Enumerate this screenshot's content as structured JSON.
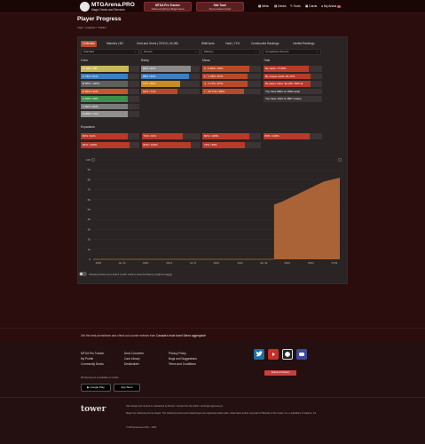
{
  "header": {
    "logo_title": "MTGArena.PRO",
    "logo_subtitle": "Magic Decks and Services",
    "promo1": {
      "title": "MTGA Pro Tracker",
      "subtitle": "Track everything in Magic Arena"
    },
    "promo2": {
      "title": "Site Tour!",
      "subtitle": "All you need to know!"
    },
    "nav": [
      "Meta",
      "Decks",
      "Tools",
      "Cards",
      "My Arena"
    ],
    "nav_badge": "1"
  },
  "page": {
    "title": "Player Progress",
    "breadcrumb": "mtga > progress > Tracker"
  },
  "tabs": [
    "Collection",
    "Matches | 8/2",
    "Gold and Gems | 29,910 | 40,060",
    "WildCards",
    "Vault | 71%",
    "Constructed Rankings",
    "Limited Rankings"
  ],
  "selects": [
    "Standard",
    "All sets",
    "Mastery",
    "Completion Percent"
  ],
  "sections": {
    "color": "Color",
    "rarity": "Rarity",
    "mana": "Mana",
    "total": "Total",
    "expansion": "Expansion"
  },
  "colors": [
    {
      "label": "W 480 / 488",
      "pct": 0.82,
      "color": "#c9b85a"
    },
    {
      "label": "U 75% / 91%",
      "pct": 0.8,
      "color": "#3d7fbf"
    },
    {
      "label": "B 80% / 100%",
      "pct": 0.8,
      "color": "#5f5f5f"
    },
    {
      "label": "R 80% / 93%",
      "pct": 0.8,
      "color": "#c9552a"
    },
    {
      "label": "G 80% / 90%",
      "pct": 0.8,
      "color": "#3e8f4a"
    },
    {
      "label": "C 80% / 80%",
      "pct": 0.8,
      "color": "#7a7a7a"
    },
    {
      "label": "M 80% / 71%",
      "pct": 0.8,
      "color": "#8f8f8f"
    }
  ],
  "rarity": [
    {
      "label": "80% / 90%",
      "pct": 0.85,
      "color": "#8a8a8a"
    },
    {
      "label": "88% / 90%",
      "pct": 0.82,
      "color": "#3d7fbf"
    },
    {
      "label": "67% / 80%",
      "pct": 0.67,
      "color": "#c98a20"
    },
    {
      "label": "62% / 71%",
      "pct": 0.62,
      "color": "#b84a2a"
    }
  ],
  "mana": [
    {
      "label": "0 - 0   81% / 92%",
      "pct": 0.81
    },
    {
      "label": "1 - 1   78% / 87%",
      "pct": 0.78
    },
    {
      "label": "4 - 4   77% / 87%",
      "pct": 0.77
    },
    {
      "label": "7 - 99  71% / 89%",
      "pct": 0.71
    }
  ],
  "total": [
    {
      "label": "By cards: 77.68%",
      "pct": 0.78
    },
    {
      "label": "By unique cards: 81.47%",
      "pct": 0.81
    },
    {
      "label": "By paper value: $4,015 / $20.1k",
      "pct": 0.8
    },
    {
      "label": "You have 5801 of 7468 cards",
      "pct": 0
    },
    {
      "label": "You have 1623 of 1867 unique",
      "pct": 0
    }
  ],
  "expansion": [
    {
      "label": "80% / 91%",
      "pct": 0.8
    },
    {
      "label": "71% / 91%",
      "pct": 0.71
    },
    {
      "label": "80% / 100%",
      "pct": 0.8
    },
    {
      "label": "80% / 100%",
      "pct": 0.8
    },
    {
      "label": "84% / 100%",
      "pct": 0.84
    },
    {
      "label": "84% / 100%",
      "pct": 0.84
    },
    {
      "label": "73% / 36%",
      "pct": 0.73
    }
  ],
  "chart_data": {
    "type": "area",
    "y_ticks": [
      "100",
      "90",
      "80",
      "70",
      "60",
      "50",
      "40",
      "30",
      "20",
      "10",
      "0"
    ],
    "x_ticks": [
      "09/20",
      "Jan '21",
      "03/21",
      "05/21",
      "Jul '21",
      "09/21",
      "11/21",
      "Jan '22",
      "03/22",
      "05/22",
      "07/22"
    ],
    "ylim": [
      0,
      100
    ],
    "series": [
      {
        "values": [
          0,
          0,
          0,
          0,
          0,
          0,
          0,
          0,
          0,
          0,
          0,
          0,
          0,
          0,
          0,
          0,
          0,
          0,
          0,
          0,
          0,
          0,
          55,
          58,
          62,
          66,
          70,
          74,
          78,
          80,
          82
        ],
        "color": "#b86a3a"
      }
    ],
    "fill_start_index": 22
  },
  "chart_toggle_label": "Showing history up to last 6 month. Click to view full history (might be laggy)",
  "promo_text": "Get the best promotions and check out course reviews from",
  "promo_link": "Canada's most loved Sierra aggregator!",
  "footer": {
    "col1": [
      "MTGA Pro Tracker",
      "My Profile",
      "Community Decks"
    ],
    "col2": [
      "Deck Converter",
      "Card Library",
      "Deckbuilder"
    ],
    "col3": [
      "Privacy Policy",
      "Bugs and Suggestions",
      "Terms and Conditions"
    ],
    "apps_title": "MTGArena.pro is available on mobile",
    "google_play": "Google Play",
    "app_store": "App Store",
    "report_btn": "Submit a Problem",
    "tower": "tower",
    "legal1": "Site design and content is maintained by Razzor. Contact the site admin: admin@mtgarena.pro",
    "legal2": "Magic the Gathering Arena, Magic: The Gathering Arena and related logos are registered trademarks, trademarks and/or copyright of Wizards of the Coast, Inc, a subsidiary of Hasbro, Inc.",
    "copyright": "© MTGArena.pro 2017 - 2022"
  }
}
